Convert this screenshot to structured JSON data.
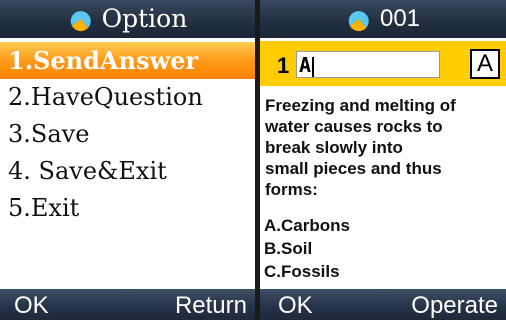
{
  "left_panel": {
    "title": "Option",
    "menu": [
      {
        "label": "1.SendAnswer",
        "selected": true
      },
      {
        "label": "2.HaveQuestion",
        "selected": false
      },
      {
        "label": "3.Save",
        "selected": false
      },
      {
        "label": "4. Save&Exit",
        "selected": false
      },
      {
        "label": "5.Exit",
        "selected": false
      }
    ],
    "softkeys": {
      "left": "OK",
      "right": "Return"
    }
  },
  "right_panel": {
    "title": "001",
    "answer": {
      "number": "1",
      "value": "A",
      "ime_mode": "A"
    },
    "question_lines": [
      "Freezing and melting of",
      "water causes rocks to",
      "break slowly into",
      "small pieces and thus",
      "forms:"
    ],
    "options": [
      "A.Carbons",
      "B.Soil",
      "C.Fossils"
    ],
    "softkeys": {
      "left": "OK",
      "right": "Operate"
    }
  },
  "colors": {
    "selection": "#ff8c00",
    "answer_bar": "#ffcc00",
    "titlebar": "#223042"
  },
  "icons": {
    "title_icon": "app-logo-icon"
  }
}
